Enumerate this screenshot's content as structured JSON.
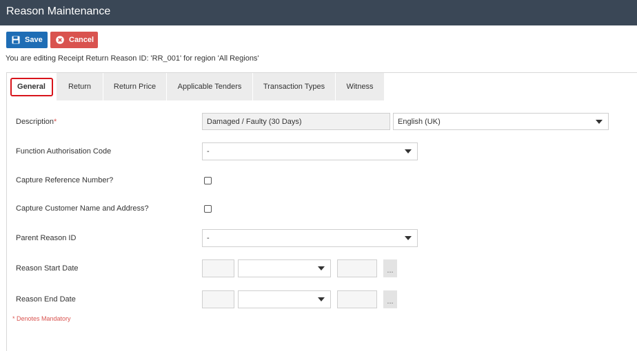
{
  "header": {
    "title": "Reason Maintenance"
  },
  "toolbar": {
    "save_label": "Save",
    "cancel_label": "Cancel"
  },
  "editing_message": "You are editing Receipt Return Reason ID: 'RR_001' for region 'All Regions'",
  "tabs": [
    {
      "label": "General",
      "active": true
    },
    {
      "label": "Return"
    },
    {
      "label": "Return Price"
    },
    {
      "label": "Applicable Tenders"
    },
    {
      "label": "Transaction Types"
    },
    {
      "label": "Witness"
    }
  ],
  "form": {
    "description_label": "Description",
    "description_required_mark": "*",
    "description_value": "Damaged / Faulty (30 Days)",
    "language_value": "English (UK)",
    "function_auth_label": "Function Authorisation Code",
    "function_auth_value": "-",
    "capture_ref_label": "Capture Reference Number?",
    "capture_ref_checked": false,
    "capture_customer_label": "Capture Customer Name and Address?",
    "capture_customer_checked": false,
    "parent_reason_label": "Parent Reason ID",
    "parent_reason_value": "-",
    "start_date_label": "Reason Start Date",
    "end_date_label": "Reason End Date",
    "date_button_label": "..."
  },
  "footer": {
    "mandatory_note": "* Denotes Mandatory"
  },
  "colors": {
    "titlebar": "#3a4756",
    "save": "#1e6db5",
    "cancel": "#d9534f",
    "active_tab_outline": "#d8141b"
  }
}
